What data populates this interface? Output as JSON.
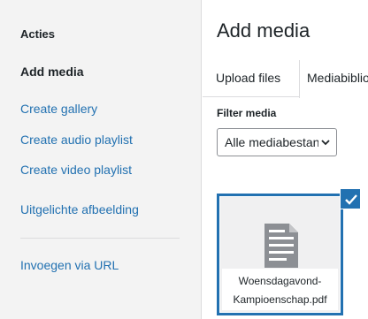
{
  "sidebar": {
    "heading": "Acties",
    "items": [
      {
        "label": "Add media",
        "active": true
      },
      {
        "label": "Create gallery"
      },
      {
        "label": "Create audio playlist"
      },
      {
        "label": "Create video playlist"
      },
      {
        "label": "Uitgelichte afbeelding"
      },
      {
        "label": "Invoegen via URL"
      }
    ]
  },
  "main": {
    "title": "Add media",
    "tabs": [
      {
        "label": "Upload files"
      },
      {
        "label": "Mediabibliotheek",
        "active": true
      }
    ],
    "filter": {
      "label": "Filter media",
      "selected": "Alle mediabestanden"
    },
    "attachments": [
      {
        "filename_line1": "Woensdagavond-",
        "filename_line2": "Kampioenschap.pdf",
        "selected": true,
        "icon": "document-icon"
      }
    ]
  },
  "colors": {
    "accent": "#2271b1",
    "sidebar_bg": "#f3f3f3",
    "text": "#1d2327"
  }
}
